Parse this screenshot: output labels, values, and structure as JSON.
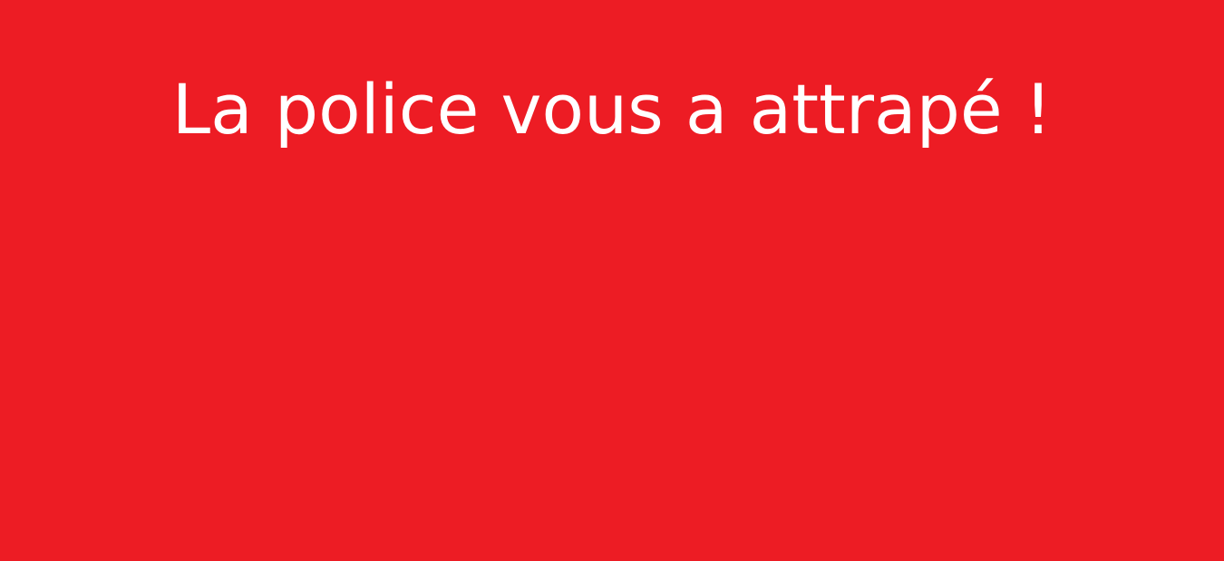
{
  "screen": {
    "message": "La police vous a attrapé !",
    "background_color": "#ED1C24",
    "text_color": "#FFFFFF"
  }
}
